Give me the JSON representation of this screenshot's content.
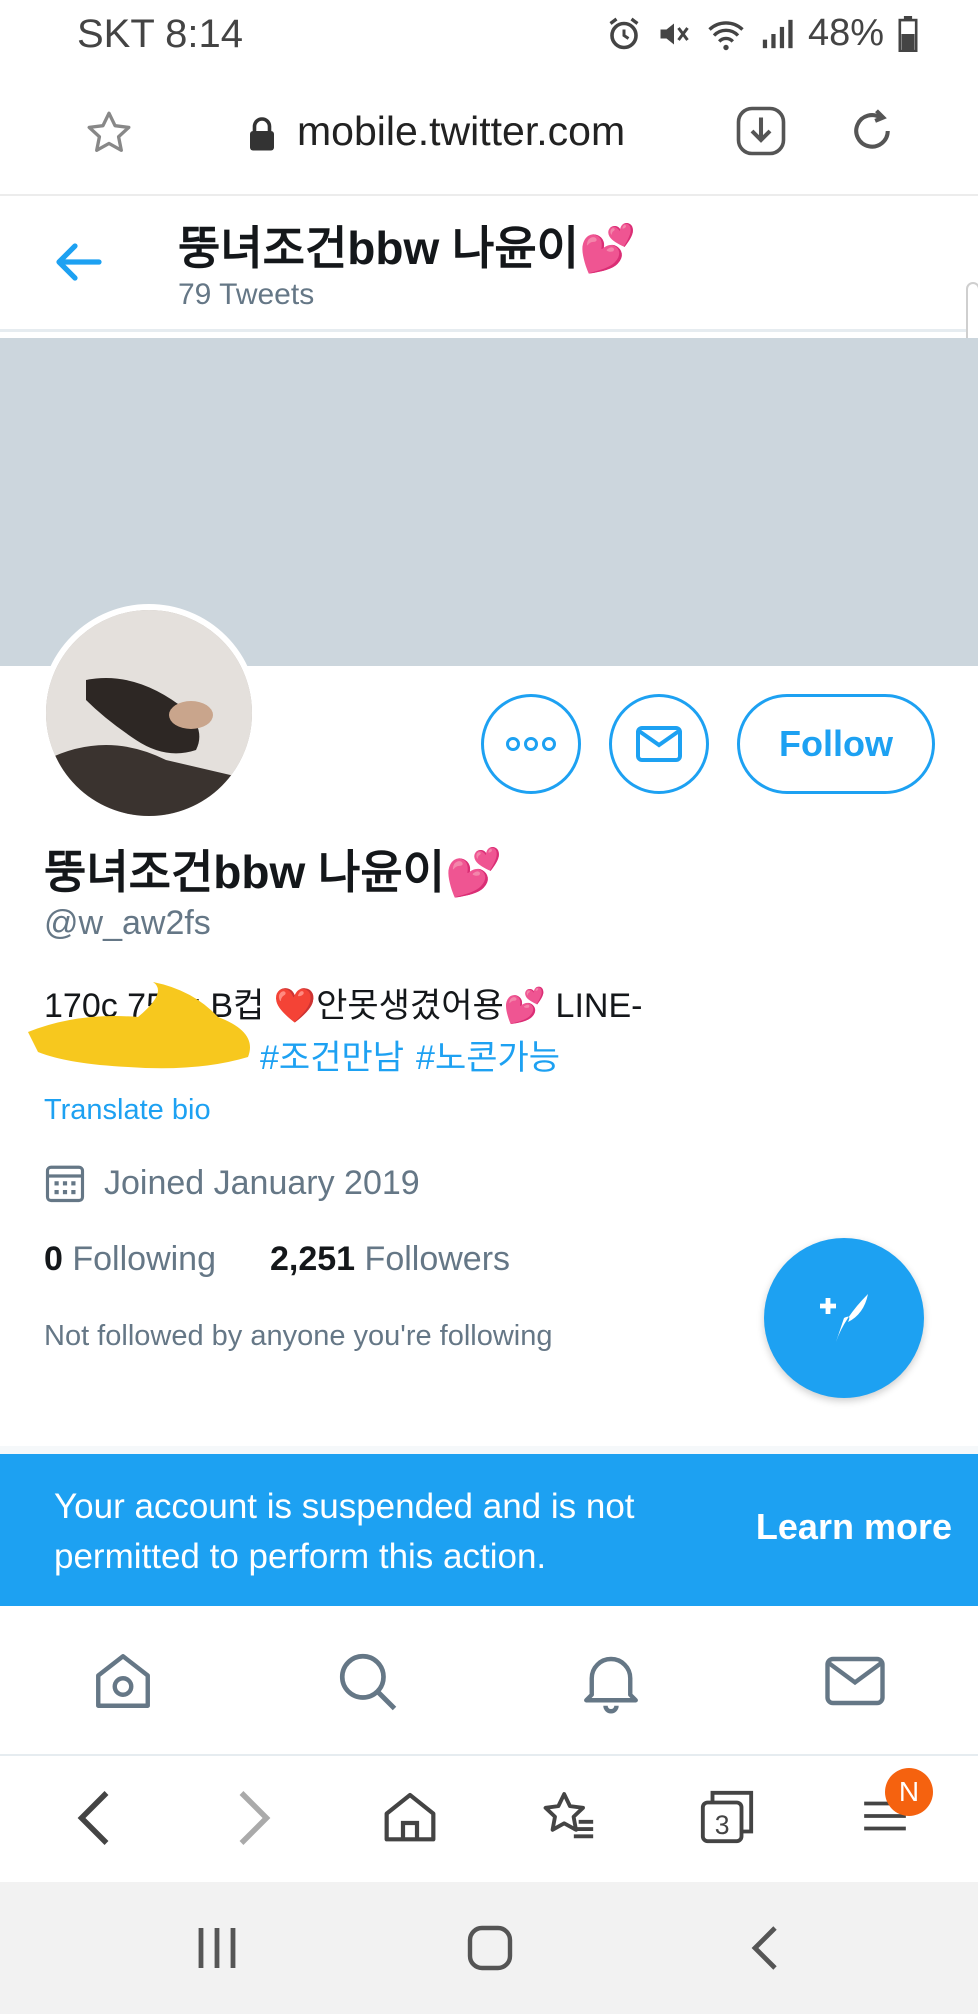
{
  "status_bar": {
    "carrier_time": "SKT 8:14",
    "battery": "48%"
  },
  "browser": {
    "url": "mobile.twitter.com",
    "tab_count": "3",
    "notification_badge": "N"
  },
  "header": {
    "title": "뚱녀조건bbw 나윤이💕",
    "tweet_count": "79 Tweets"
  },
  "profile": {
    "name": "뚱녀조건bbw 나윤이💕",
    "handle": "@w_aw2fs",
    "bio_line1": "170c 75kg,B컵 ❤️안못생겼어용💕 LINE-",
    "hashtags": [
      "#조건만남",
      "#노콘가능"
    ],
    "translate_label": "Translate bio",
    "joined": "Joined January 2019",
    "following_count": "0",
    "following_label": "Following",
    "followers_count": "2,251",
    "followers_label": "Followers",
    "not_followed": "Not followed by anyone you're following"
  },
  "actions": {
    "follow_label": "Follow"
  },
  "suspension": {
    "message": "Your account is suspended and is not permitted to perform this action.",
    "learn_more": "Learn more"
  },
  "colors": {
    "accent": "#1da1f2",
    "banner": "#ccd6dd",
    "secondary_text": "#657786",
    "badge": "#f5620f"
  },
  "icons": {
    "twitter_nav": [
      "home-icon",
      "search-icon",
      "bell-icon",
      "mail-icon"
    ],
    "browser_nav": [
      "back-icon",
      "forward-icon",
      "home-icon",
      "bookmarks-icon",
      "tabs-icon",
      "menu-icon"
    ],
    "system_nav": [
      "recents-icon",
      "home-icon",
      "back-icon"
    ]
  }
}
